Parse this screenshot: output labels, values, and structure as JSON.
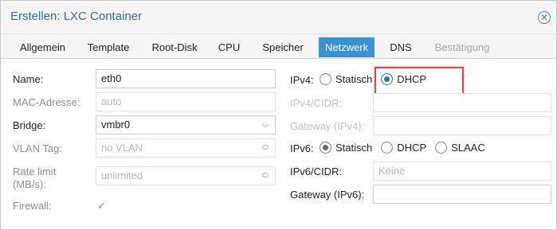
{
  "dialog": {
    "title": "Erstellen: LXC Container"
  },
  "tabs": [
    {
      "label": "Allgemein"
    },
    {
      "label": "Template"
    },
    {
      "label": "Root-Disk"
    },
    {
      "label": "CPU"
    },
    {
      "label": "Speicher"
    },
    {
      "label": "Netzwerk",
      "active": true
    },
    {
      "label": "DNS"
    },
    {
      "label": "Bestätigung",
      "disabled": true
    }
  ],
  "left": {
    "name": {
      "label": "Name:",
      "value": "eth0"
    },
    "mac": {
      "label": "MAC-Adresse:",
      "placeholder": "auto"
    },
    "bridge": {
      "label": "Bridge:",
      "value": "vmbr0"
    },
    "vlan": {
      "label": "VLAN Tag:",
      "placeholder": "no VLAN"
    },
    "rate": {
      "label_line1": "Rate limit",
      "label_line2": "(MB/s):",
      "placeholder": "unlimited"
    },
    "firewall": {
      "label": "Firewall:",
      "checked": true
    }
  },
  "right": {
    "ipv4": {
      "label": "IPv4:",
      "options": [
        "Statisch",
        "DHCP"
      ],
      "selected": "DHCP"
    },
    "ipv4_cidr": {
      "label": "IPv4/CIDR:"
    },
    "gateway4": {
      "label": "Gateway (IPv4):"
    },
    "ipv6": {
      "label": "IPv6:",
      "options": [
        "Statisch",
        "DHCP",
        "SLAAC"
      ],
      "selected": "Statisch"
    },
    "ipv6_cidr": {
      "label": "IPv6/CIDR:",
      "placeholder": "Keine"
    },
    "gateway6": {
      "label": "Gateway (IPv6):"
    }
  },
  "colors": {
    "accent": "#3892d4",
    "title": "#2a6db5",
    "highlight": "#e34545"
  }
}
